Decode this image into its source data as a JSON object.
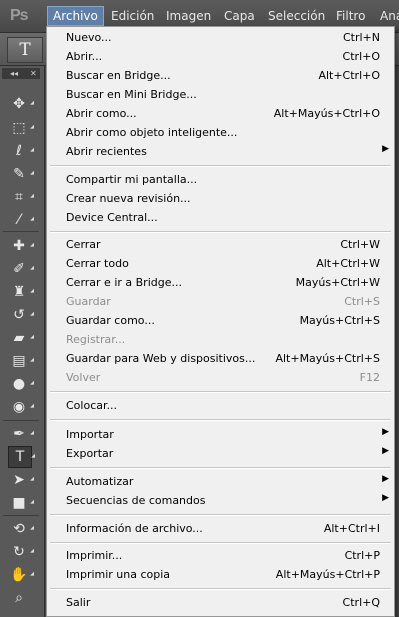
{
  "app": {
    "logo": "Ps"
  },
  "menubar": {
    "items": [
      "Archivo",
      "Edición",
      "Imagen",
      "Capa",
      "Selección",
      "Filtro",
      "Aná"
    ]
  },
  "options": {
    "tool_glyph": "T"
  },
  "toolbox": {
    "collapse_glyph": "◂◂",
    "close_glyph": "✕"
  },
  "menu": {
    "items": [
      {
        "label": "Nuevo...",
        "shortcut": "Ctrl+N"
      },
      {
        "label": "Abrir...",
        "shortcut": "Ctrl+O"
      },
      {
        "label": "Buscar en Bridge...",
        "shortcut": "Alt+Ctrl+O"
      },
      {
        "label": "Buscar en Mini Bridge...",
        "shortcut": ""
      },
      {
        "label": "Abrir como...",
        "shortcut": "Alt+Mayús+Ctrl+O"
      },
      {
        "label": "Abrir como objeto inteligente...",
        "shortcut": ""
      },
      {
        "label": "Abrir recientes",
        "shortcut": "",
        "submenu": "▶"
      },
      {
        "label": "Compartir mi pantalla...",
        "shortcut": ""
      },
      {
        "label": "Crear nueva revisión...",
        "shortcut": ""
      },
      {
        "label": "Device Central...",
        "shortcut": ""
      },
      {
        "label": "Cerrar",
        "shortcut": "Ctrl+W"
      },
      {
        "label": "Cerrar todo",
        "shortcut": "Alt+Ctrl+W"
      },
      {
        "label": "Cerrar e ir a Bridge...",
        "shortcut": "Mayús+Ctrl+W"
      },
      {
        "label": "Guardar",
        "shortcut": "Ctrl+S",
        "disabled": true
      },
      {
        "label": "Guardar como...",
        "shortcut": "Mayús+Ctrl+S"
      },
      {
        "label": "Registrar...",
        "shortcut": "",
        "disabled": true
      },
      {
        "label": "Guardar para Web y dispositivos...",
        "shortcut": "Alt+Mayús+Ctrl+S"
      },
      {
        "label": "Volver",
        "shortcut": "F12",
        "disabled": true
      },
      {
        "label": "Colocar...",
        "shortcut": ""
      },
      {
        "label": "Importar",
        "shortcut": "",
        "submenu": "▶"
      },
      {
        "label": "Exportar",
        "shortcut": "",
        "submenu": "▶"
      },
      {
        "label": "Automatizar",
        "shortcut": "",
        "submenu": "▶"
      },
      {
        "label": "Secuencias de comandos",
        "shortcut": "",
        "submenu": "▶"
      },
      {
        "label": "Información de archivo...",
        "shortcut": "Alt+Ctrl+I"
      },
      {
        "label": "Imprimir...",
        "shortcut": "Ctrl+P"
      },
      {
        "label": "Imprimir una copia",
        "shortcut": "Alt+Mayús+Ctrl+P"
      },
      {
        "label": "Salir",
        "shortcut": "Ctrl+Q"
      }
    ]
  }
}
